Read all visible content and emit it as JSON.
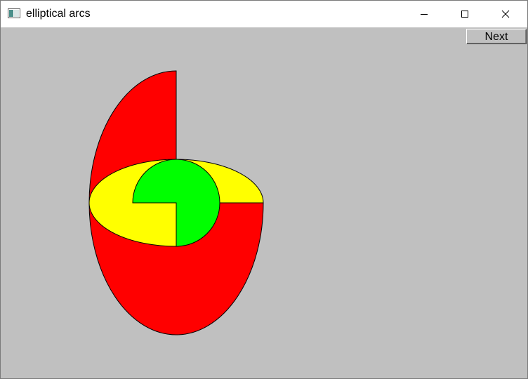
{
  "window": {
    "title": "elliptical arcs",
    "icon": "app-window-icon",
    "controls": [
      "minimize-icon",
      "maximize-icon",
      "close-icon"
    ]
  },
  "toolbar": {
    "next_label": "Next"
  },
  "colors": {
    "client_background": "#c0c0c0",
    "large_arc": "#ff0000",
    "middle_arc": "#ffff00",
    "small_arc": "#00ff00",
    "outline": "#000000"
  }
}
